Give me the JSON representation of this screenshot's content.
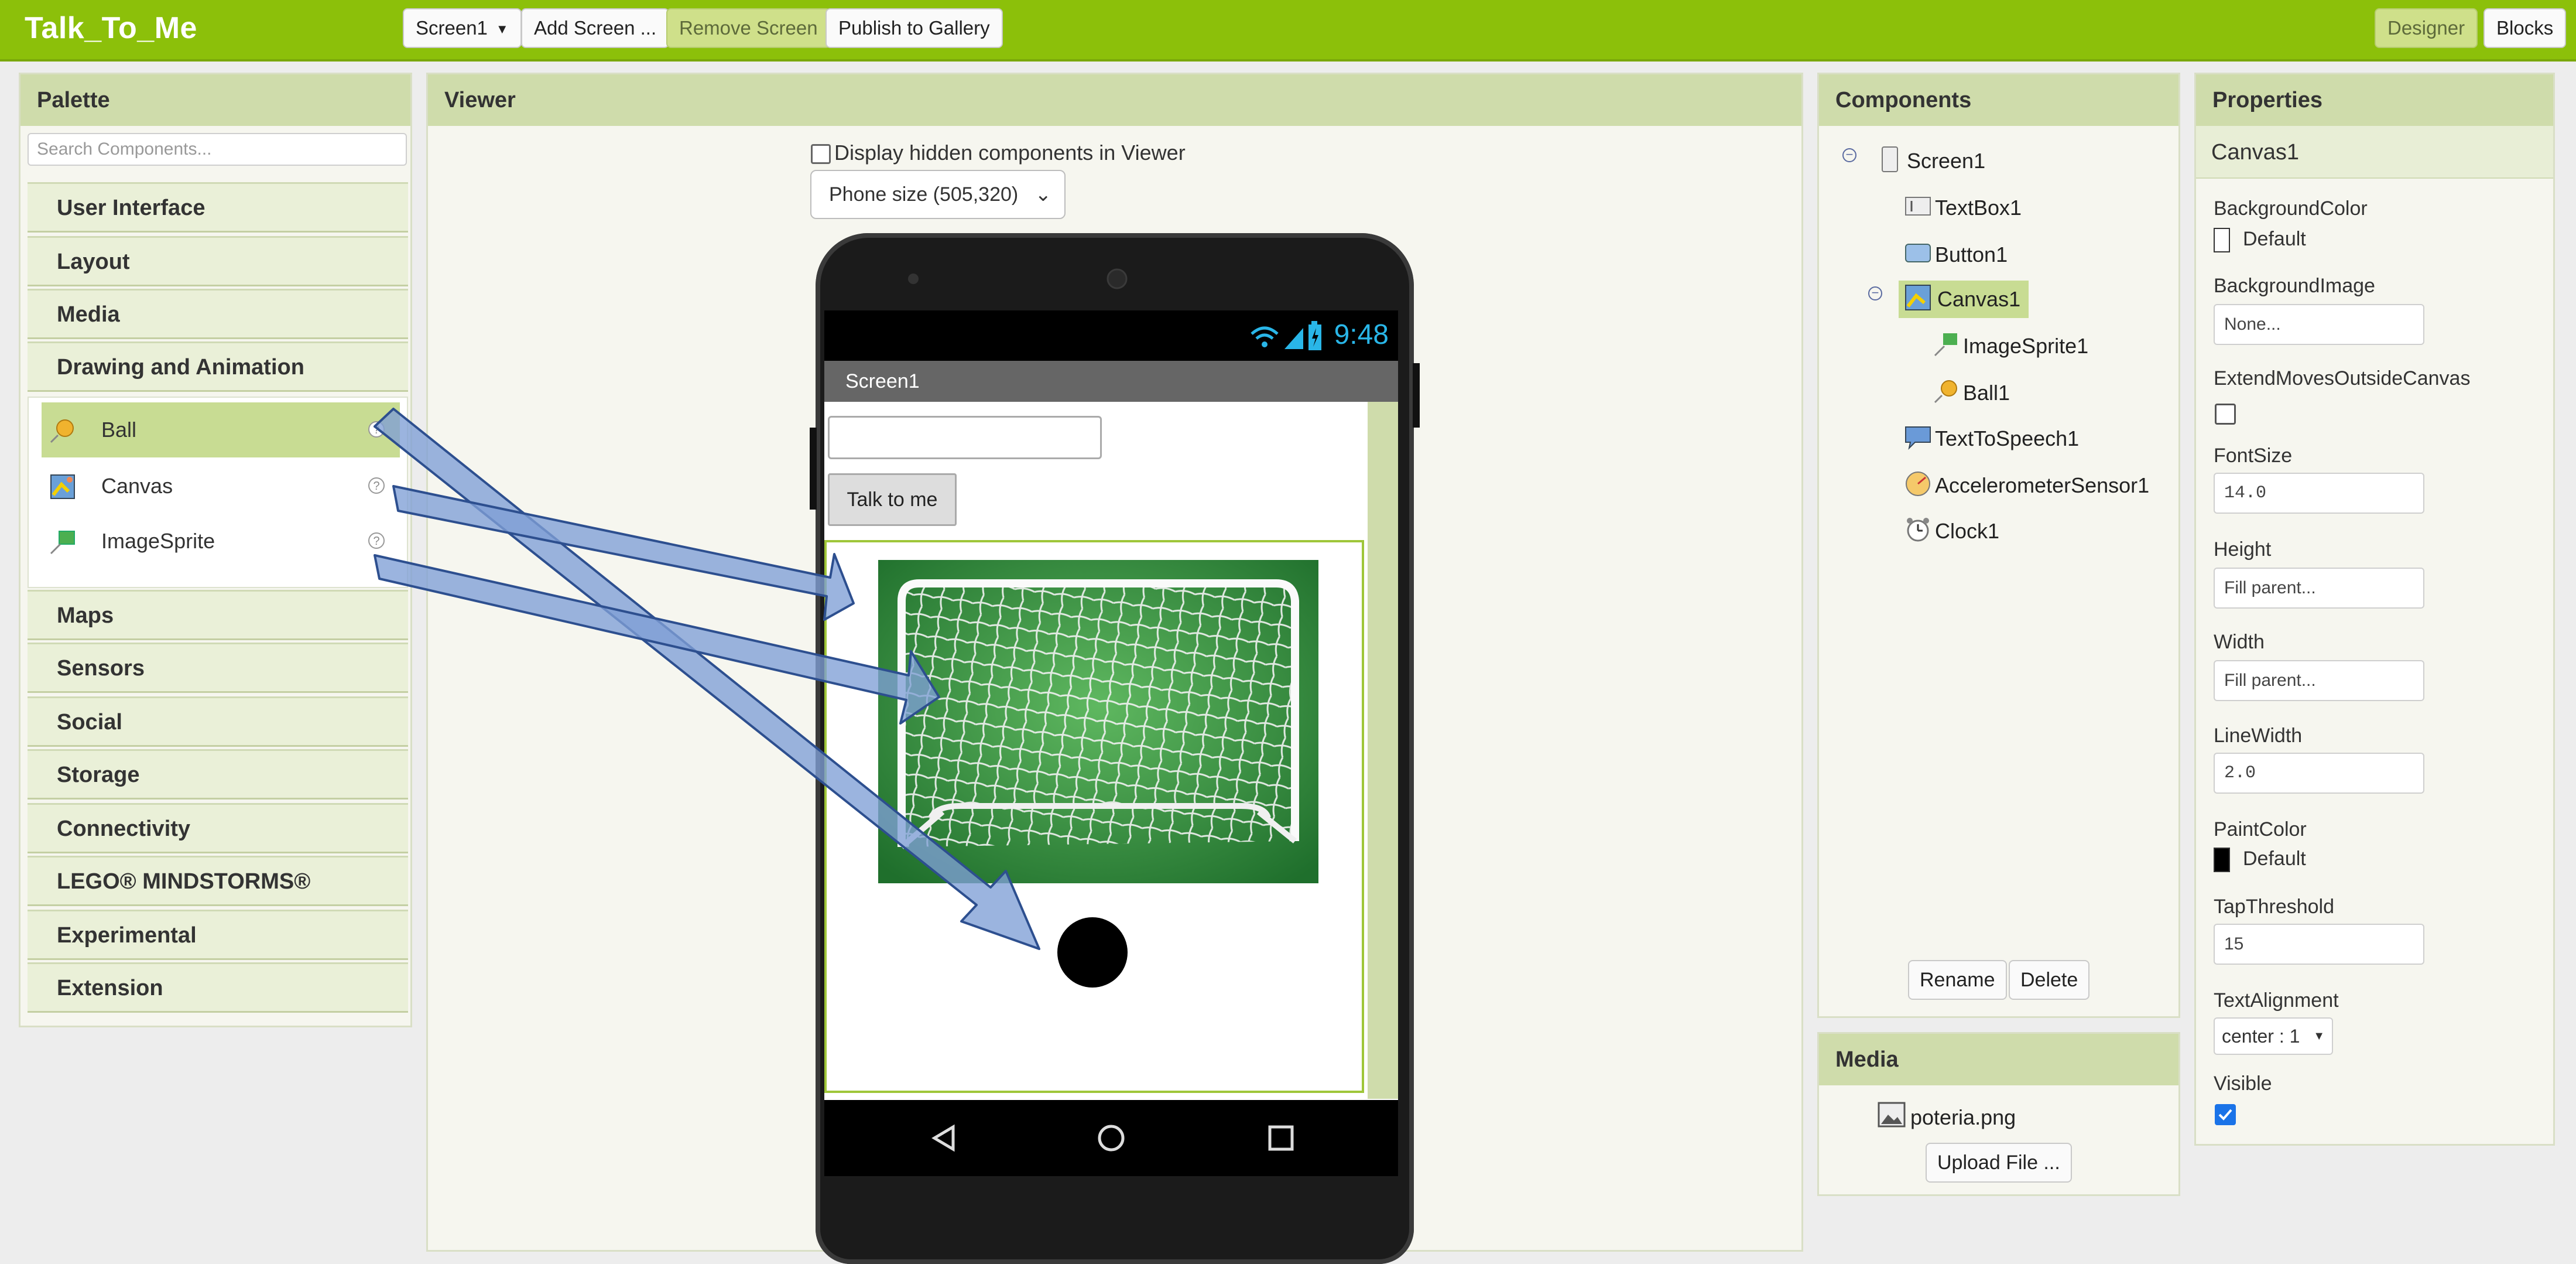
{
  "app": {
    "title": "Talk_To_Me",
    "toolbar": {
      "screen_select": "Screen1",
      "add_screen": "Add Screen ...",
      "remove_screen": "Remove Screen",
      "publish": "Publish to Gallery",
      "designer": "Designer",
      "blocks": "Blocks"
    }
  },
  "palette": {
    "header": "Palette",
    "search_placeholder": "Search Components...",
    "categories_top": [
      "User Interface",
      "Layout",
      "Media",
      "Drawing and Animation"
    ],
    "items": [
      {
        "label": "Ball",
        "icon": "ball-icon",
        "selected": true
      },
      {
        "label": "Canvas",
        "icon": "canvas-icon"
      },
      {
        "label": "ImageSprite",
        "icon": "imagesprite-icon"
      }
    ],
    "categories_bottom": [
      "Maps",
      "Sensors",
      "Social",
      "Storage",
      "Connectivity",
      "LEGO® MINDSTORMS®",
      "Experimental",
      "Extension"
    ]
  },
  "viewer": {
    "header": "Viewer",
    "hidden_checkbox_label": "Display hidden components in Viewer",
    "phone_size": "Phone size (505,320)",
    "phone": {
      "time": "9:48",
      "screen_title": "Screen1",
      "button_label": "Talk to me"
    }
  },
  "components": {
    "header": "Components",
    "tree": [
      {
        "label": "Screen1",
        "icon": "screen-icon"
      },
      {
        "label": "TextBox1",
        "icon": "textbox-icon"
      },
      {
        "label": "Button1",
        "icon": "button-icon"
      },
      {
        "label": "Canvas1",
        "icon": "canvas-icon",
        "selected": true
      },
      {
        "label": "ImageSprite1",
        "icon": "imagesprite-icon"
      },
      {
        "label": "Ball1",
        "icon": "ball-icon"
      },
      {
        "label": "TextToSpeech1",
        "icon": "speech-icon"
      },
      {
        "label": "AccelerometerSensor1",
        "icon": "accelerometer-icon"
      },
      {
        "label": "Clock1",
        "icon": "clock-icon"
      }
    ],
    "rename": "Rename",
    "delete": "Delete"
  },
  "media": {
    "header": "Media",
    "file": "poteria.png",
    "upload": "Upload File ..."
  },
  "properties": {
    "header": "Properties",
    "component": "Canvas1",
    "background_color_label": "BackgroundColor",
    "background_color_value": "Default",
    "background_image_label": "BackgroundImage",
    "background_image_value": "None...",
    "extend_label": "ExtendMovesOutsideCanvas",
    "extend_checked": false,
    "fontsize_label": "FontSize",
    "fontsize_value": "14.0",
    "height_label": "Height",
    "height_value": "Fill parent...",
    "width_label": "Width",
    "width_value": "Fill parent...",
    "linewidth_label": "LineWidth",
    "linewidth_value": "2.0",
    "paint_color_label": "PaintColor",
    "paint_color_value": "Default",
    "tap_threshold_label": "TapThreshold",
    "tap_threshold_value": "15",
    "text_alignment_label": "TextAlignment",
    "text_alignment_value": "center : 1",
    "visible_label": "Visible",
    "visible_checked": true
  },
  "colors": {
    "topbar": "#8cc00a",
    "panel_header": "#cfdcab",
    "selection": "#c8dc93",
    "arrow_fill": "#7f9fd6",
    "arrow_stroke": "#2d4f8f",
    "clock_text": "#29b6e8"
  }
}
